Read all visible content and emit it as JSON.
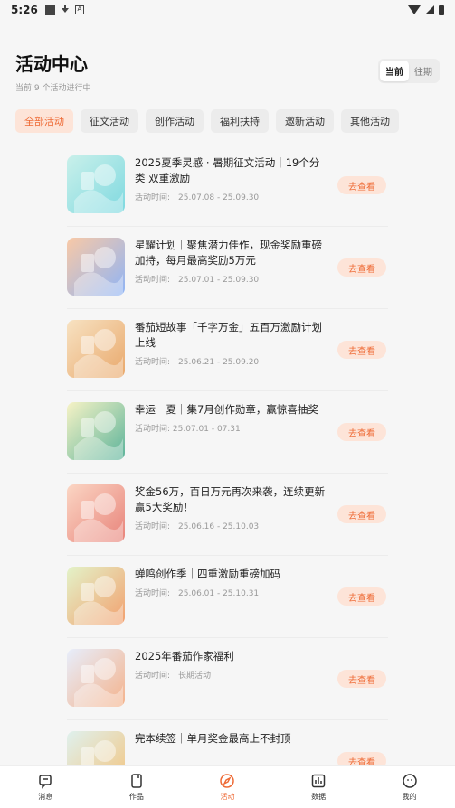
{
  "status_bar": {
    "time": "5:26"
  },
  "header": {
    "title": "活动中心",
    "subtitle": "当前 9 个活动进行中",
    "segment": {
      "current": "当前",
      "past": "往期",
      "selected": "当前"
    }
  },
  "filters": [
    {
      "label": "全部活动",
      "active": true
    },
    {
      "label": "征文活动",
      "active": false
    },
    {
      "label": "创作活动",
      "active": false
    },
    {
      "label": "福利扶持",
      "active": false
    },
    {
      "label": "邀新活动",
      "active": false
    },
    {
      "label": "其他活动",
      "active": false
    }
  ],
  "activities": [
    {
      "title": "2025夏季灵感 · 暑期征文活动｜19个分类 双重激励",
      "time": "活动时间:　25.07.08 - 25.09.30",
      "button": "去查看",
      "thumb_colors": [
        "#c9f0ea",
        "#7fd9e0"
      ]
    },
    {
      "title": "星耀计划｜聚焦潜力佳作，现金奖励重磅加持，每月最高奖励5万元",
      "time": "活动时间:　25.07.01 - 25.09.30",
      "button": "去查看",
      "thumb_colors": [
        "#f9c9a6",
        "#8fb4f5"
      ]
    },
    {
      "title": "番茄短故事「千字万金」五百万激励计划上线",
      "time": "活动时间:　25.06.21 - 25.09.20",
      "button": "去查看",
      "thumb_colors": [
        "#f7e2c2",
        "#e9a86b"
      ]
    },
    {
      "title": "幸运一夏｜集7月创作勋章，赢惊喜抽奖",
      "time": "活动时间: 25.07.01 - 07.31",
      "button": "去查看",
      "thumb_colors": [
        "#f7f3c6",
        "#5bb39a"
      ]
    },
    {
      "title": "奖金56万，百日万元再次来袭，连续更新赢5大奖励！",
      "time": "活动时间:　25.06.16 - 25.10.03",
      "button": "去查看",
      "thumb_colors": [
        "#fbd6c4",
        "#e8837a"
      ]
    },
    {
      "title": "蝉鸣创作季｜四重激励重磅加码",
      "time": "活动时间:　25.06.01 - 25.10.31",
      "button": "去查看",
      "thumb_colors": [
        "#e3f3c9",
        "#f2a06e"
      ]
    },
    {
      "title": "2025年番茄作家福利",
      "time": "活动时间:　长期活动",
      "button": "去查看",
      "thumb_colors": [
        "#e7eefc",
        "#f4b28b"
      ]
    },
    {
      "title": "完本续签｜单月奖金最高上不封顶",
      "time": "",
      "button": "去查看",
      "thumb_colors": [
        "#dff1ee",
        "#f3c47e"
      ]
    }
  ],
  "tabbar": [
    {
      "label": "消息",
      "icon": "message-icon",
      "active": false
    },
    {
      "label": "作品",
      "icon": "works-icon",
      "active": false
    },
    {
      "label": "活动",
      "icon": "compass-icon",
      "active": true
    },
    {
      "label": "数据",
      "icon": "chart-icon",
      "active": false
    },
    {
      "label": "我的",
      "icon": "profile-icon",
      "active": false
    }
  ],
  "colors": {
    "accent": "#ee6a35",
    "accent_bg": "#fde4d8"
  }
}
